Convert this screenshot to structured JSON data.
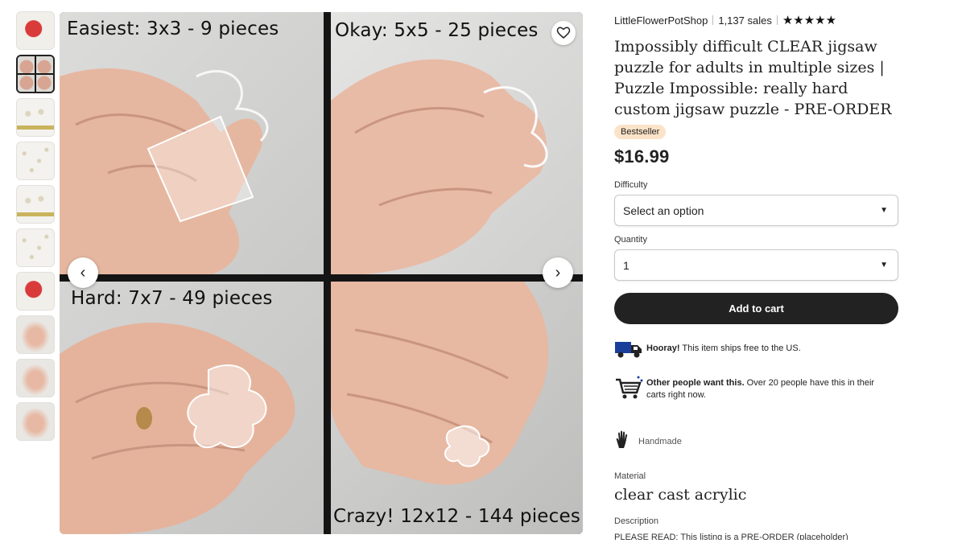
{
  "gallery": {
    "thumbnails": [
      {
        "kind": "redtag"
      },
      {
        "kind": "grid4",
        "active": true
      },
      {
        "kind": "barsy"
      },
      {
        "kind": "dots"
      },
      {
        "kind": "barsy"
      },
      {
        "kind": "dots"
      },
      {
        "kind": "redtag"
      },
      {
        "kind": "hand"
      },
      {
        "kind": "hand"
      },
      {
        "kind": "hand"
      }
    ],
    "quadrants": [
      {
        "label": "Easiest: 3x3 - 9 pieces"
      },
      {
        "label": "Okay: 5x5 - 25 pieces"
      },
      {
        "label": "Hard: 7x7 - 49 pieces"
      },
      {
        "label": "Crazy! 12x12 - 144 pieces"
      }
    ],
    "prev_icon": "‹",
    "next_icon": "›"
  },
  "product": {
    "shop_name": "LittleFlowerPotShop",
    "sales": "1,137 sales",
    "stars": "★★★★★",
    "title": "Impossibly difficult CLEAR jigsaw puzzle for adults in multiple sizes | Puzzle Impossible: really hard custom jigsaw puzzle - PRE-ORDER",
    "badge": "Bestseller",
    "price": "$16.99",
    "difficulty_label": "Difficulty",
    "difficulty_value": "Select an option",
    "quantity_label": "Quantity",
    "quantity_value": "1",
    "add_to_cart": "Add to cart",
    "shipping_bold": "Hooray!",
    "shipping_text": " This item ships free to the US.",
    "demand_bold": "Other people want this.",
    "demand_text": " Over 20 people have this in their carts right now.",
    "handmade": "Handmade",
    "material_label": "Material",
    "material_value": "clear cast acrylic",
    "description_label": "Description",
    "description_preview": "PLEASE READ: This listing is a PRE-ORDER (placeholder)"
  },
  "colors": {
    "accent_dark": "#222222",
    "badge_bg": "#fbe3c8",
    "truck_blue": "#1a3f9b"
  }
}
